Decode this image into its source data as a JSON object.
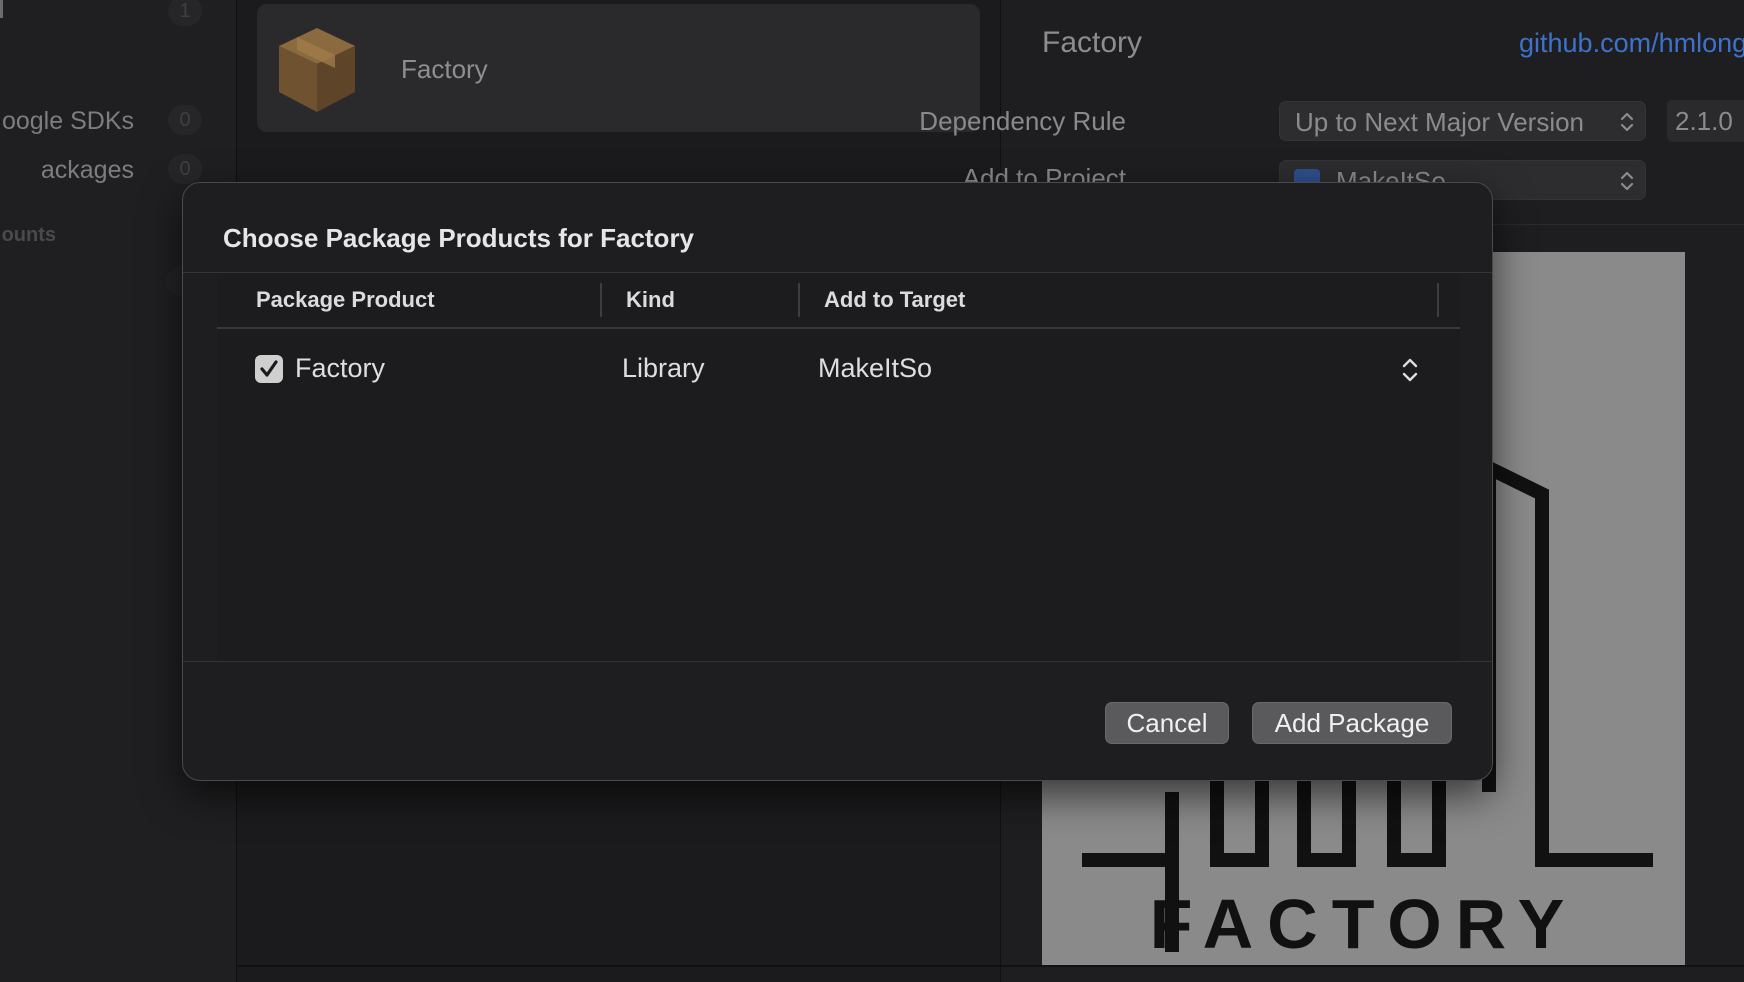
{
  "sidebar": {
    "top_count": "1",
    "items": [
      {
        "label": "oogle SDKs",
        "count": "0"
      },
      {
        "label": "ackages",
        "count": "0"
      }
    ],
    "section_label": "ounts"
  },
  "center": {
    "package_name": "Factory"
  },
  "details": {
    "title": "Factory",
    "repo_link": "github.com/hmlong",
    "dependency_rule_label": "Dependency Rule",
    "dependency_rule_value": "Up to Next Major Version",
    "version": "2.1.0",
    "add_to_project_label": "Add to Project",
    "add_to_project_value": "MakeItSo",
    "logo_text": "FACTORY"
  },
  "dialog": {
    "title": "Choose Package Products for Factory",
    "columns": [
      "Package Product",
      "Kind",
      "Add to Target"
    ],
    "rows": [
      {
        "product": "Factory",
        "kind": "Library",
        "target": "MakeItSo",
        "checked": true
      }
    ],
    "cancel_label": "Cancel",
    "add_label": "Add Package"
  },
  "colors": {
    "link": "#3d72c9",
    "package_icon": "#7a5a34"
  }
}
